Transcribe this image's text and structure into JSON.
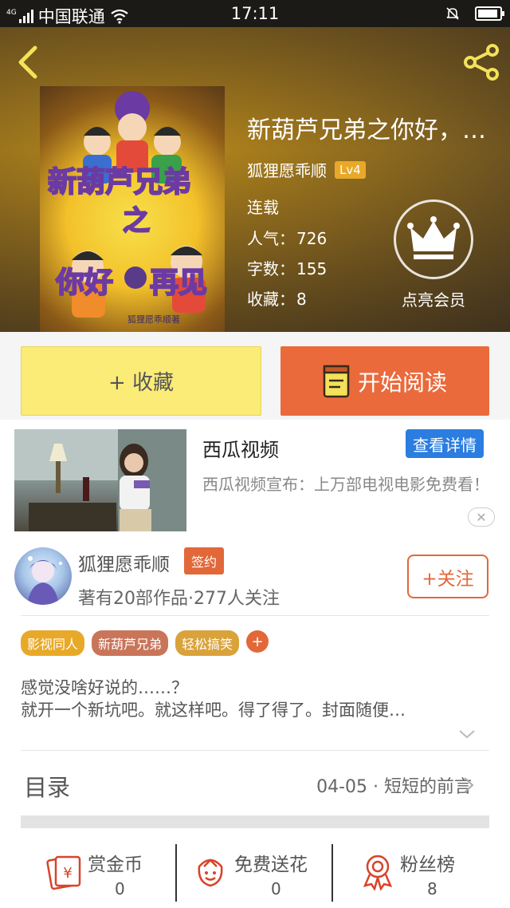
{
  "status_bar": {
    "signal_tag": "4G",
    "carrier": "中国联通",
    "time": "17:11"
  },
  "header": {
    "book_title": "新葫芦兄弟之你好，…",
    "author": "狐狸愿乖顺",
    "level": "Lv4",
    "cover_title_line1": "新葫芦兄弟",
    "cover_title_line2": "之",
    "cover_title_line3": "你好",
    "cover_title_line4": "再见",
    "cover_credit": "狐狸愿乖顺著",
    "status": "连载",
    "popularity_label": "人气：",
    "popularity": "726",
    "words_label": "字数：",
    "words": "155",
    "favorites_label": "收藏：",
    "favorites": "8",
    "vip_label": "点亮会员"
  },
  "actions": {
    "collect_label": "+ 收藏",
    "read_label": "开始阅读"
  },
  "ad": {
    "title": "西瓜视频",
    "button": "查看详情",
    "description": "西瓜视频宣布：上万部电视电影免费看！",
    "close": "✕"
  },
  "author_card": {
    "name": "狐狸愿乖顺",
    "badge": "签约",
    "stats": "著有20部作品·277人关注",
    "follow": "+关注"
  },
  "tags": [
    {
      "label": "影视同人",
      "color": "#e8a928"
    },
    {
      "label": "新葫芦兄弟",
      "color": "#c9755a"
    },
    {
      "label": "轻松搞笑",
      "color": "#d9a23a"
    }
  ],
  "tag_add": "+",
  "intro": {
    "line1": "感觉没啥好说的……？",
    "line2": "就开一个新坑吧。就这样吧。得了得了。封面随便…"
  },
  "toc": {
    "title": "目录",
    "latest": "04-05 · 短短的前言"
  },
  "rewards": [
    {
      "label": "赏金币",
      "count": "0",
      "icon": "gold-coin-icon"
    },
    {
      "label": "免费送花",
      "count": "0",
      "icon": "flower-icon"
    },
    {
      "label": "粉丝榜",
      "count": "8",
      "icon": "medal-icon"
    }
  ],
  "colors": {
    "accent": "#e2683a",
    "collect_bg": "#fbec78",
    "ad_button": "#2b7de0",
    "level_badge": "#e8a928"
  }
}
